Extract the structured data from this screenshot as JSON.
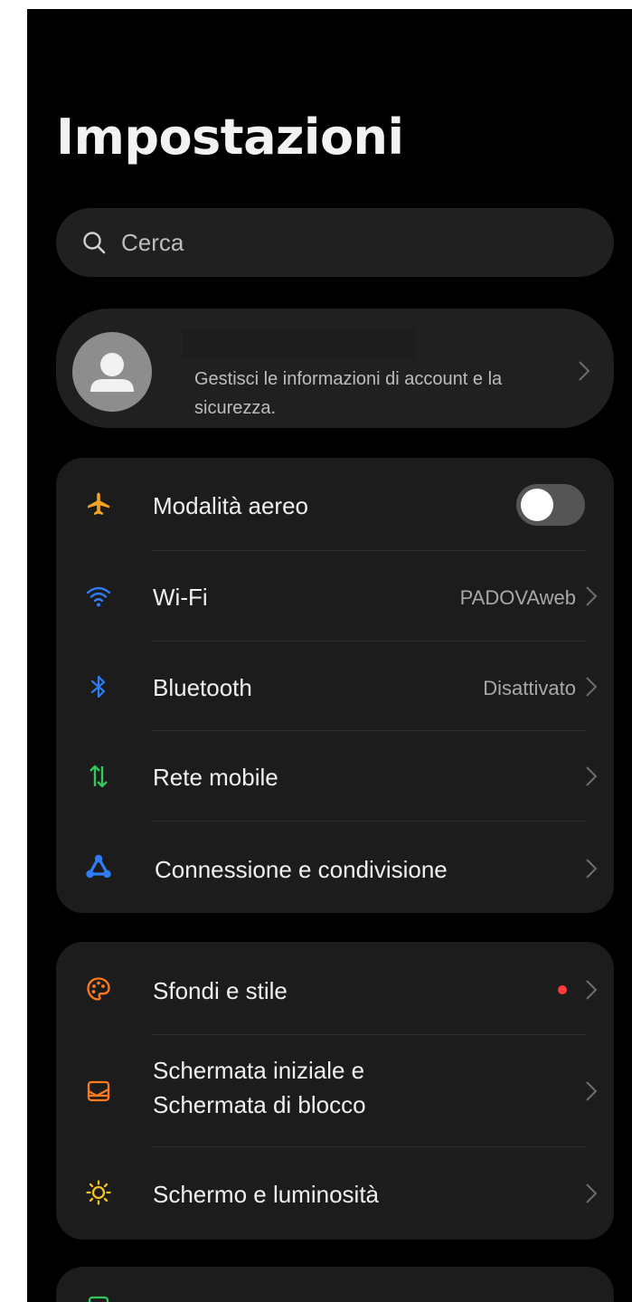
{
  "title": "Impostazioni",
  "search": {
    "placeholder": "Cerca"
  },
  "account": {
    "description": "Gestisci le informazioni di account e la sicurezza."
  },
  "connectivity": {
    "airplane": {
      "label": "Modalità aereo",
      "enabled": false
    },
    "wifi": {
      "label": "Wi-Fi",
      "value": "PADOVAweb"
    },
    "bluetooth": {
      "label": "Bluetooth",
      "value": "Disattivato"
    },
    "mobile": {
      "label": "Rete mobile"
    },
    "sharing": {
      "label": "Connessione e condivisione"
    }
  },
  "personalization": {
    "wallpaper": {
      "label": "Sfondi e stile",
      "has_badge": true
    },
    "home_lock": {
      "line1": "Schermata iniziale e",
      "line2": "Schermata di blocco"
    },
    "display": {
      "label": "Schermo e luminosità"
    }
  },
  "colors": {
    "airplane": "#f4a322",
    "wifi": "#2f7df6",
    "bluetooth": "#2f7df6",
    "mobile": "#35c759",
    "sharing": "#2f7df6",
    "wallpaper": "#ff7a1a",
    "home_lock": "#ff7a1a",
    "display": "#f4c21f",
    "badge": "#ff3b3b"
  },
  "icons": {
    "search": "search-icon",
    "avatar": "person-icon",
    "airplane": "airplane-icon",
    "wifi": "wifi-icon",
    "bluetooth": "bluetooth-icon",
    "mobile": "mobile-data-icon",
    "sharing": "share-connection-icon",
    "wallpaper": "palette-icon",
    "home_lock": "home-screen-icon",
    "display": "sun-icon",
    "chevron": "chevron-right-icon"
  }
}
